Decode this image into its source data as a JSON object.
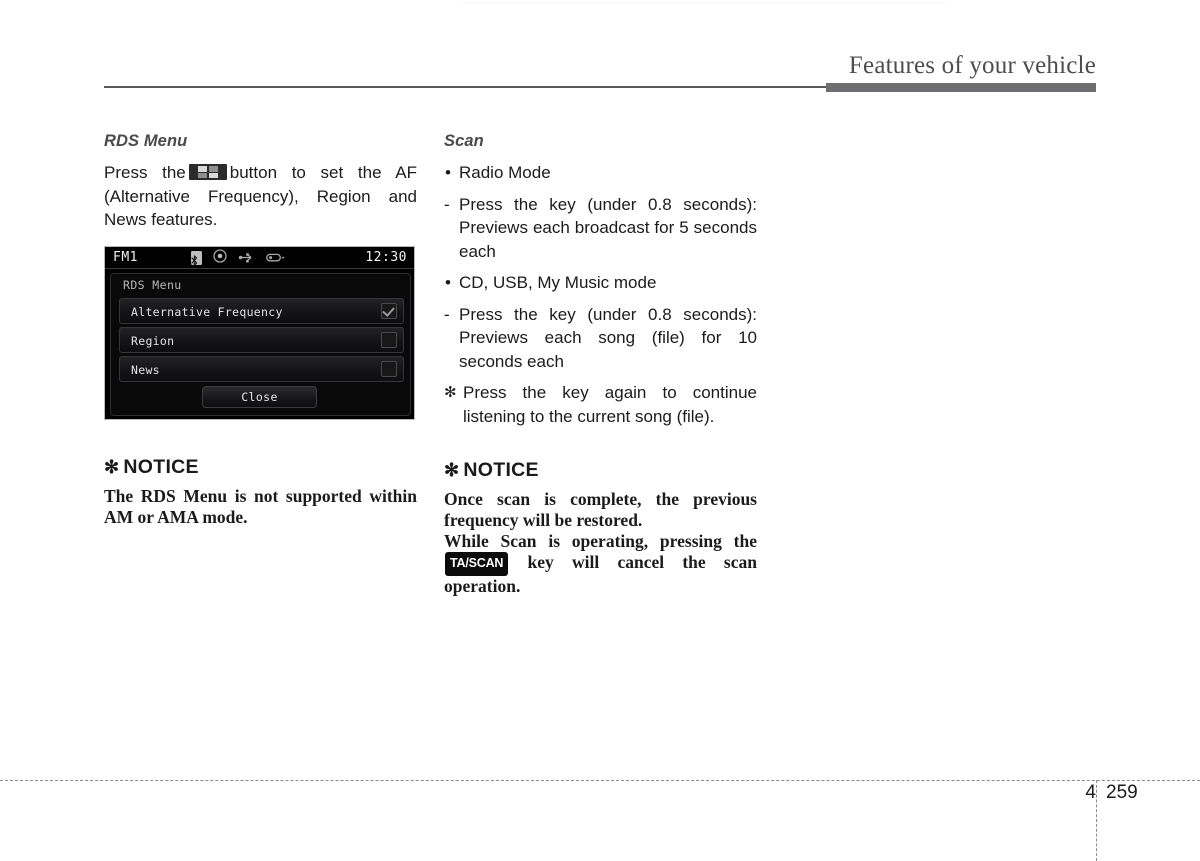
{
  "header": {
    "title": "Features of your vehicle"
  },
  "left_column": {
    "section_heading": "RDS Menu",
    "intro_before_icon": "Press the",
    "button_icon_name": "rds-menu-button-icon",
    "intro_after_icon": "button to set the AF (Alternative Frequency), Region and News features.",
    "device": {
      "source_label": "FM1",
      "clock": "12:30",
      "status_icons": [
        "bluetooth-icon",
        "disc-icon",
        "usb-icon",
        "device-icon"
      ],
      "panel_title": "RDS Menu",
      "rows": [
        {
          "label": "Alternative Frequency",
          "checked": true
        },
        {
          "label": "Region",
          "checked": false
        },
        {
          "label": "News",
          "checked": false
        }
      ],
      "close_label": "Close"
    },
    "notice": {
      "star": "✻",
      "heading": "NOTICE",
      "body": "The RDS Menu is not supported within AM or AMA mode."
    }
  },
  "right_column": {
    "section_heading": "Scan",
    "items": [
      {
        "marker": "•",
        "type": "bullet",
        "text": "Radio Mode"
      },
      {
        "marker": "-",
        "type": "dash",
        "text": "Press the key (under 0.8 seconds): Previews each broadcast for 5 seconds each"
      },
      {
        "marker": "•",
        "type": "bullet",
        "text": "CD, USB, My Music mode"
      },
      {
        "marker": "-",
        "type": "dash",
        "text": "Press the key (under 0.8 seconds): Previews each song (file) for 10 seconds each"
      },
      {
        "marker": "✻",
        "type": "star",
        "text": "Press the key again to continue listening to the current song (file)."
      }
    ],
    "notice": {
      "star": "✻",
      "heading": "NOTICE",
      "line1": "Once scan is complete, the previous frequency will be restored.",
      "line2_before_key": "While Scan is operating, pressing the",
      "key_badge": "TA/SCAN",
      "line2_after_key": "key will cancel the scan operation."
    }
  },
  "footer": {
    "chapter": "4",
    "page": "259"
  }
}
